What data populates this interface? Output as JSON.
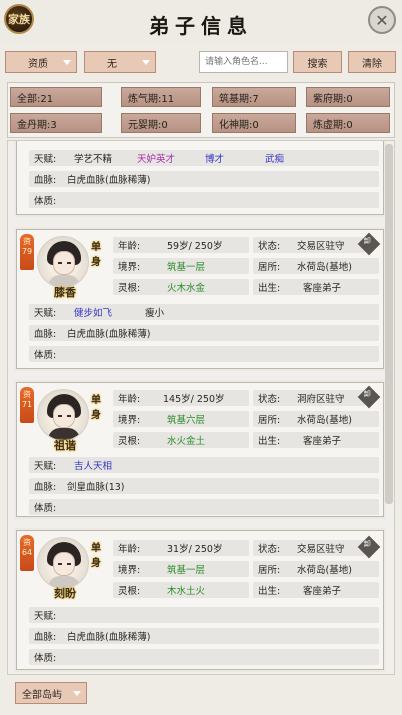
{
  "header": {
    "family_label": "家族",
    "title": "弟子信息",
    "close_icon": "close-x"
  },
  "filters": {
    "aptitude_label": "资质",
    "second_filter_value": "无",
    "search_placeholder": "请输入角色名...",
    "search_button": "搜索",
    "clear_button": "清除"
  },
  "stats": [
    {
      "label": "全部:21"
    },
    {
      "label": "炼气期:11"
    },
    {
      "label": "筑基期:7"
    },
    {
      "label": "紫府期:0"
    },
    {
      "label": "金丹期:3"
    },
    {
      "label": "元婴期:0"
    },
    {
      "label": "化神期:0"
    },
    {
      "label": "炼虚期:0"
    }
  ],
  "partial_card": {
    "talent_label": "天赋:",
    "talents": [
      "学艺不精",
      "天妒英才",
      "博才",
      "武痴"
    ],
    "bloodline_label": "血脉:",
    "bloodline": "白虎血脉(血脉稀薄)",
    "constitution_label": "体质:"
  },
  "cards": [
    {
      "rank": "资79",
      "status_tag": "单身",
      "name": "膝香",
      "age_label": "年龄:",
      "age": "59岁/ 250岁",
      "state_label": "状态:",
      "state": "交易区驻守",
      "realm_label": "境界:",
      "realm": "筑基一层",
      "residence_label": "居所:",
      "residence": "水荷岛(基地)",
      "root_label": "灵根:",
      "root": "火木水金",
      "origin_label": "出生:",
      "origin": "客座弟子",
      "talent_label": "天赋:",
      "talents": [
        "健步如飞",
        "瘦小"
      ],
      "bloodline_label": "血脉:",
      "bloodline": "白虎血脉(血脉稀薄)",
      "constitution_label": "体质:",
      "constitution": "",
      "action": "卸"
    },
    {
      "rank": "资71",
      "status_tag": "单身",
      "name": "祖谐",
      "age_label": "年龄:",
      "age": "145岁/ 250岁",
      "state_label": "状态:",
      "state": "洞府区驻守",
      "realm_label": "境界:",
      "realm": "筑基六层",
      "residence_label": "居所:",
      "residence": "水荷岛(基地)",
      "root_label": "灵根:",
      "root": "水火金土",
      "origin_label": "出生:",
      "origin": "客座弟子",
      "talent_label": "天赋:",
      "talents": [
        "吉人天相"
      ],
      "bloodline_label": "血脉:",
      "bloodline": "剑皇血脉(13)",
      "constitution_label": "体质:",
      "constitution": "",
      "action": "卸"
    },
    {
      "rank": "资64",
      "status_tag": "单身",
      "name": "刻盼",
      "age_label": "年龄:",
      "age": "31岁/ 250岁",
      "state_label": "状态:",
      "state": "交易区驻守",
      "realm_label": "境界:",
      "realm": "筑基一层",
      "residence_label": "居所:",
      "residence": "水荷岛(基地)",
      "root_label": "灵根:",
      "root": "木水土火",
      "origin_label": "出生:",
      "origin": "客座弟子",
      "talent_label": "天赋:",
      "talents": [],
      "bloodline_label": "血脉:",
      "bloodline": "白虎血脉(血脉稀薄)",
      "constitution_label": "体质:",
      "constitution": "",
      "action": "卸"
    }
  ],
  "footer": {
    "island_filter": "全部岛屿"
  },
  "colors": {
    "accent": "#e8c9b6",
    "stat_bg": "#c0a090",
    "realm_green": "#2b8b2b",
    "talent_blue": "#3535c8",
    "talent_purple": "#a62aa8"
  }
}
